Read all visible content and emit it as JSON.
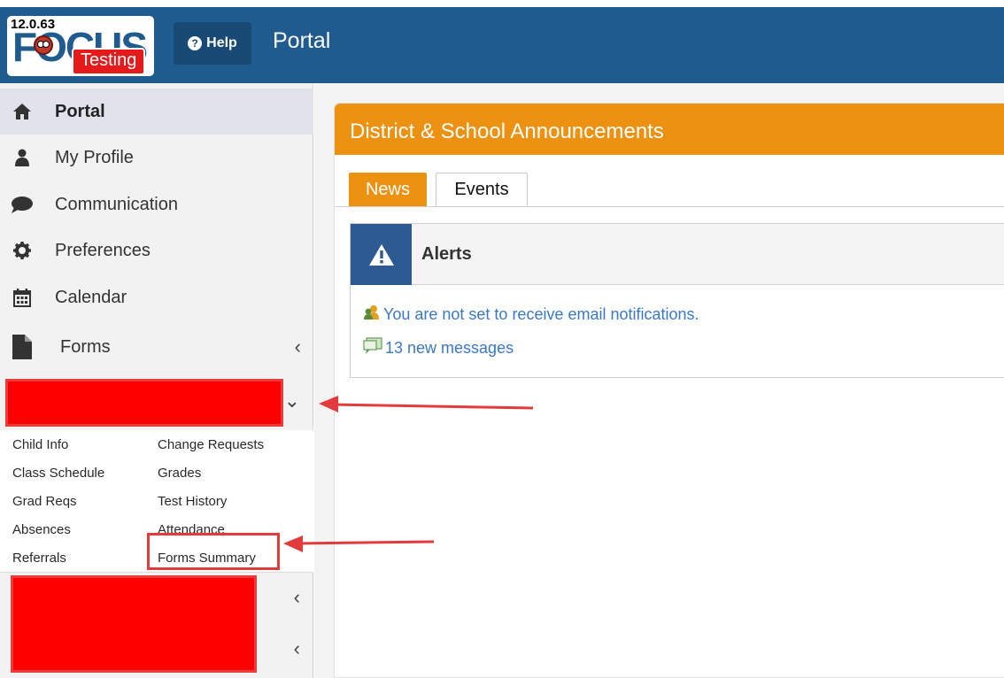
{
  "header": {
    "version": "12.0.63",
    "brand_text": "FOCUS",
    "testing_label": "Testing",
    "help_label": "Help",
    "title": "Portal"
  },
  "sidebar": {
    "items": [
      {
        "label": "Portal",
        "icon": "home-icon",
        "active": true
      },
      {
        "label": "My Profile",
        "icon": "user-icon"
      },
      {
        "label": "Communication",
        "icon": "speech-bubble-icon"
      },
      {
        "label": "Preferences",
        "icon": "gear-icon"
      },
      {
        "label": "Calendar",
        "icon": "calendar-icon"
      },
      {
        "label": "Forms",
        "icon": "document-icon",
        "chevron": "left"
      }
    ],
    "student_chevron": "down",
    "sub_links_left": [
      "Child Info",
      "Class Schedule",
      "Grad Reqs",
      "Absences",
      "Referrals"
    ],
    "sub_links_right": [
      "Change Requests",
      "Grades",
      "Test History",
      "Attendance",
      "Forms Summary"
    ],
    "bottom_chevrons": [
      "left",
      "left"
    ]
  },
  "main": {
    "panel_title": "District & School Announcements",
    "tabs": [
      {
        "label": "News",
        "active": true
      },
      {
        "label": "Events",
        "active": false
      }
    ],
    "alerts": {
      "title": "Alerts",
      "icon": "warning-icon",
      "items": [
        {
          "text": "You are not set to receive email notifications.",
          "icon": "users-icon"
        },
        {
          "text": "13 new messages",
          "icon": "message-icon"
        }
      ]
    }
  },
  "colors": {
    "header": "#1f5b8f",
    "accent_orange": "#ec9110",
    "alert_blue": "#2d5a93",
    "link_blue": "#3b78c4",
    "annotation_red": "#e33b3b"
  }
}
